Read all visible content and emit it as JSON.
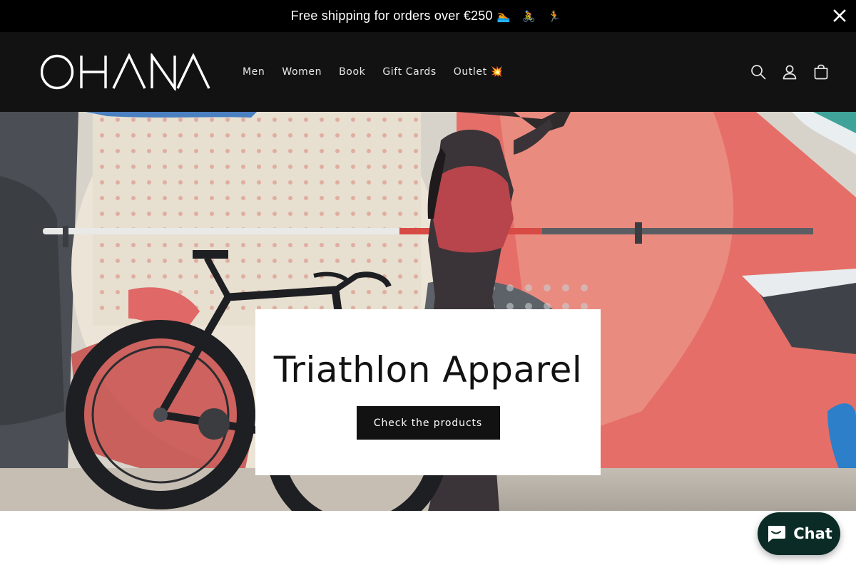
{
  "announcement": {
    "text": "Free shipping for orders over €250",
    "emoji": "🏊 🚴 🏃",
    "close_icon": "close-icon"
  },
  "header": {
    "logo_text": "OHANA",
    "nav": [
      {
        "label": "Men"
      },
      {
        "label": "Women"
      },
      {
        "label": "Book"
      },
      {
        "label": "Gift Cards"
      },
      {
        "label": "Outlet 💥"
      }
    ],
    "icons": [
      "search-icon",
      "account-icon",
      "cart-icon"
    ]
  },
  "hero": {
    "title": "Triathlon Apparel",
    "button_label": "Check the products"
  },
  "chat": {
    "label": "Chat",
    "icon": "chat-bubble-icon",
    "color": "#0b2c26"
  },
  "colors": {
    "announcement_bg": "#000000",
    "header_bg": "#121212",
    "button_bg": "#121212"
  }
}
